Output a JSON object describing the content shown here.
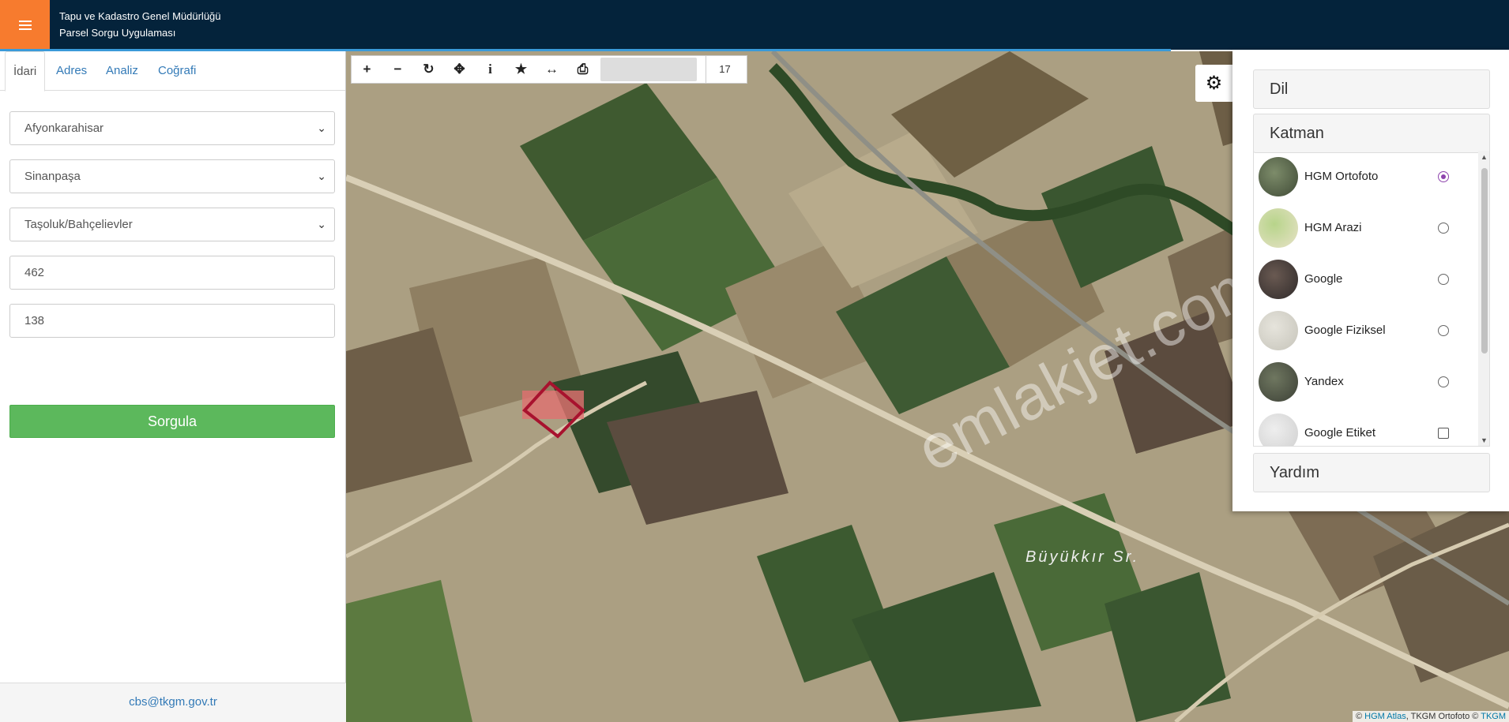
{
  "header": {
    "title_line1": "Tapu ve Kadastro Genel Müdürlüğü",
    "title_line2": "Parsel Sorgu Uygulaması"
  },
  "left_panel": {
    "tabs": [
      {
        "label": "İdari",
        "active": true
      },
      {
        "label": "Adres",
        "active": false
      },
      {
        "label": "Analiz",
        "active": false
      },
      {
        "label": "Coğrafi",
        "active": false
      }
    ],
    "province": "Afyonkarahisar",
    "district": "Sinanpaşa",
    "neighborhood": "Taşoluk/Bahçelievler",
    "block_no": "462",
    "parcel_no": "138",
    "query_button": "Sorgula",
    "footer_email": "cbs@tkgm.gov.tr"
  },
  "map": {
    "zoom_level": "17",
    "watermark": "emlakjet.com",
    "place_label": "Büyükkır Sr.",
    "attribution_prefix": "© ",
    "attribution_link1": "HGM Atlas",
    "attribution_mid": ", TKGM Ortofoto © ",
    "attribution_link2": "TKGM",
    "tool_icons": [
      "zoom-in-icon",
      "zoom-out-icon",
      "refresh-icon",
      "locate-icon",
      "info-icon",
      "star-icon",
      "measure-icon",
      "print-icon"
    ]
  },
  "right_panel": {
    "section_language": "Dil",
    "section_layer": "Katman",
    "section_help": "Yardım",
    "layers": [
      {
        "name": "HGM Ortofoto",
        "selected": true
      },
      {
        "name": "HGM Arazi",
        "selected": false
      },
      {
        "name": "Google",
        "selected": false
      },
      {
        "name": "Google Fiziksel",
        "selected": false
      },
      {
        "name": "Yandex",
        "selected": false
      },
      {
        "name": "Google Etiket",
        "selected": false
      }
    ]
  },
  "colors": {
    "header_bg": "#04233b",
    "menu_button": "#f77b2e",
    "query_button": "#5cb85c",
    "selected_radio": "#8e44ad"
  }
}
